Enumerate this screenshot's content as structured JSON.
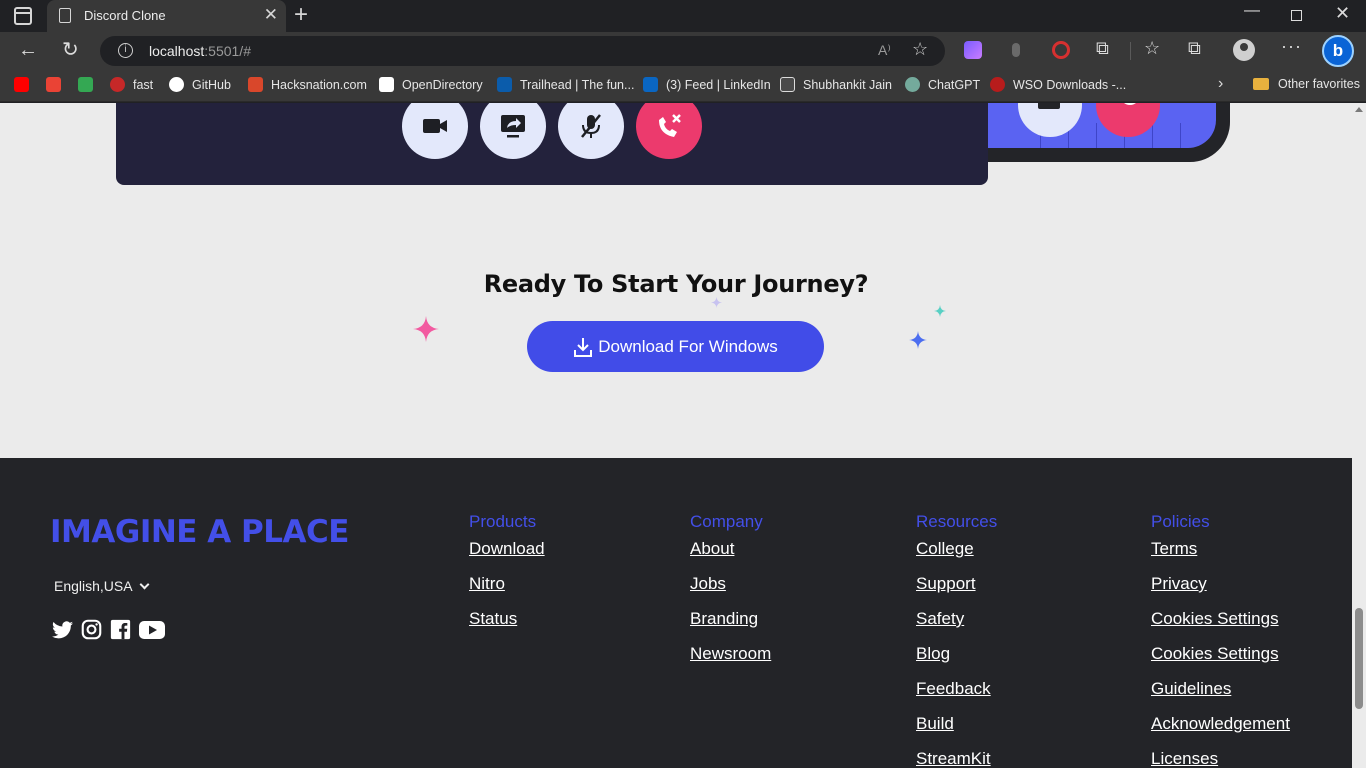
{
  "browser": {
    "tab_title": "Discord Clone",
    "url_host": "localhost",
    "url_rest": ":5501/#",
    "read_aloud": "A⁾",
    "bing_label": "b",
    "bookmarks": [
      {
        "label": "",
        "color": "#ff0000"
      },
      {
        "label": "",
        "color": "#ea4335"
      },
      {
        "label": "",
        "color": "#34a853"
      },
      {
        "label": "fast",
        "color": "#c62828"
      },
      {
        "label": "GitHub",
        "color": "#ffffff"
      },
      {
        "label": "Hacksnation.com",
        "color": "#d9472b"
      },
      {
        "label": "OpenDirectory",
        "color": "#ffffff"
      },
      {
        "label": "Trailhead | The fun...",
        "color": "#0b5cab"
      },
      {
        "label": "(3) Feed | LinkedIn",
        "color": "#0a66c2"
      },
      {
        "label": "Shubhankit Jain",
        "color": "#dcdcdc"
      },
      {
        "label": "ChatGPT",
        "color": "#74aa9c"
      },
      {
        "label": "WSO Downloads -...",
        "color": "#b71c1c"
      }
    ],
    "other_favorites": "Other favorites"
  },
  "cta": {
    "title": "Ready To Start Your Journey?",
    "button_label": "Download For Windows"
  },
  "footer": {
    "brand": "IMAGINE A PLACE",
    "language": "English,USA",
    "social_icons": [
      "twitter-icon",
      "instagram-icon",
      "facebook-icon",
      "youtube-icon"
    ],
    "columns": [
      {
        "heading": "Products",
        "links": [
          "Download",
          "Nitro",
          "Status"
        ]
      },
      {
        "heading": "Company",
        "links": [
          "About",
          "Jobs",
          "Branding",
          "Newsroom"
        ]
      },
      {
        "heading": "Resources",
        "links": [
          "College",
          "Support",
          "Safety",
          "Blog",
          "Feedback",
          "Build",
          "StreamKit"
        ]
      },
      {
        "heading": "Policies",
        "links": [
          "Terms",
          "Privacy",
          "Cookies Settings",
          "Cookies Settings",
          "Guidelines",
          "Acknowledgement",
          "Licenses"
        ]
      }
    ]
  },
  "colors": {
    "accent": "#434fe8",
    "button": "#414ce8",
    "hangup": "#ec3a6d",
    "footer_bg": "#232428",
    "page_bg": "#ebebeb"
  }
}
